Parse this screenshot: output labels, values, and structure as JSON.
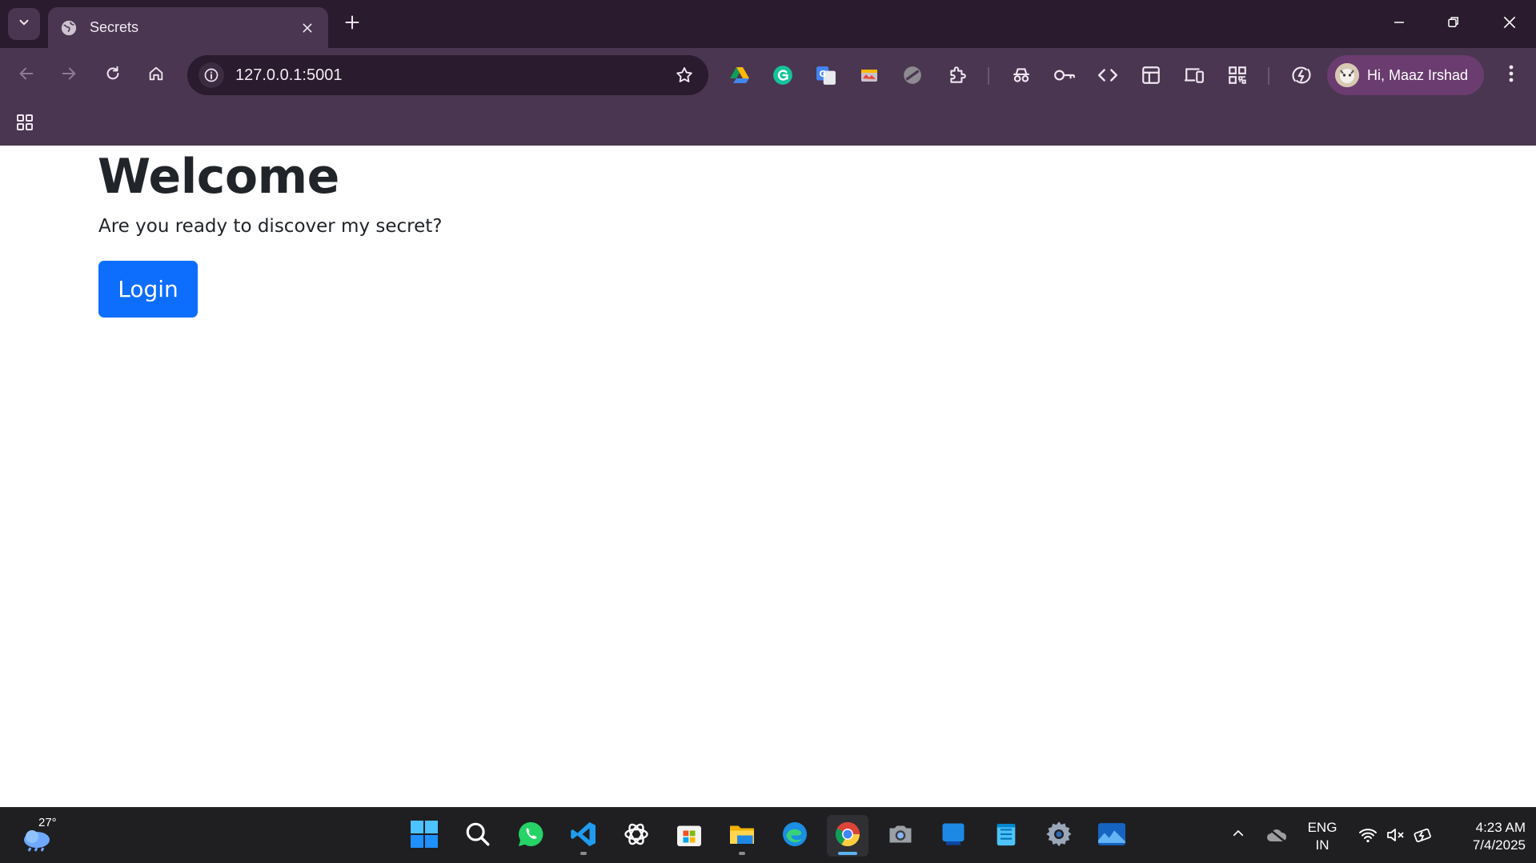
{
  "browser": {
    "tab": {
      "title": "Secrets"
    },
    "address_bar": {
      "url": "127.0.0.1:5001"
    },
    "profile": {
      "name": "Hi, Maaz Irshad"
    },
    "extensions": [
      "google-drive-icon",
      "grammarly-icon",
      "google-translate-icon",
      "screenshot-icon",
      "blocked-icon",
      "puzzle-icon",
      "incognito-icon",
      "key-icon",
      "code-icon",
      "layout-icon",
      "devices-icon",
      "qr-code-icon",
      "lightning-icon"
    ]
  },
  "page": {
    "heading": "Welcome",
    "text": "Are you ready to discover my secret?",
    "login_button": "Login",
    "accent": "#0d6efd"
  },
  "taskbar": {
    "weather": {
      "temperature": "27°"
    },
    "apps": [
      "windows-start",
      "search",
      "whatsapp",
      "vscode",
      "chatgpt",
      "microsoft-store",
      "file-explorer",
      "edge",
      "chrome",
      "camera",
      "blue-app",
      "notepad",
      "settings",
      "photos"
    ],
    "language": {
      "line1": "ENG",
      "line2": "IN"
    },
    "clock": {
      "time": "4:23 AM",
      "date": "7/4/2025"
    }
  }
}
